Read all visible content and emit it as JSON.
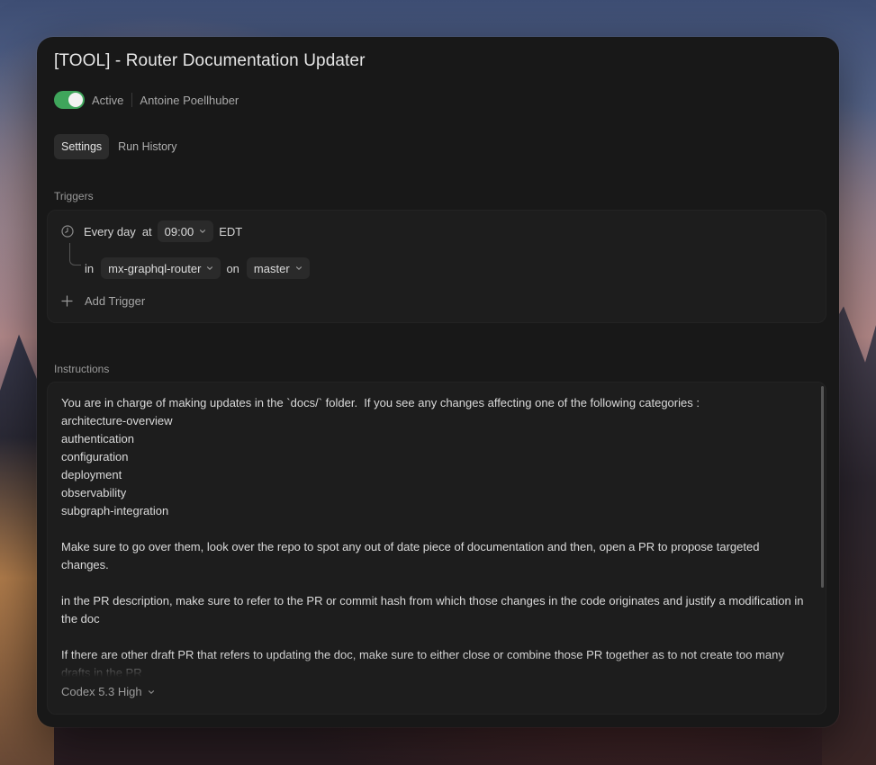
{
  "window": {
    "title": "[TOOL] - Router Documentation Updater",
    "status": {
      "active": true,
      "label": "Active",
      "owner": "Antoine Poellhuber"
    },
    "tabs": [
      {
        "label": "Settings",
        "active": true
      },
      {
        "label": "Run History",
        "active": false
      }
    ]
  },
  "triggers": {
    "section_label": "Triggers",
    "schedule": {
      "frequency": "Every day",
      "at_label": "at",
      "time": "09:00",
      "timezone": "EDT"
    },
    "repo": {
      "in_label": "in",
      "repository": "mx-graphql-router",
      "on_label": "on",
      "branch": "master"
    },
    "add_label": "Add Trigger"
  },
  "instructions": {
    "section_label": "Instructions",
    "text": "You are in charge of making updates in the `docs/` folder.  If you see any changes affecting one of the following categories :\narchitecture-overview\nauthentication\nconfiguration\ndeployment\nobservability\nsubgraph-integration\n\nMake sure to go over them, look over the repo to spot any out of date piece of documentation and then, open a PR to propose targeted changes.\n\nin the PR description, make sure to refer to the PR or commit hash from which those changes in the code originates and justify a modification in the doc\n\nIf there are other draft PR that refers to updating the doc, make sure to either close or combine those PR together as to not create too many drafts in the PR",
    "model": "Codex 5.3 High"
  },
  "colors": {
    "toggle_active": "#3fa55b",
    "panel_bg": "#181818",
    "box_bg": "#1d1d1d"
  },
  "icons": {
    "schedule": "clock-icon",
    "add": "plus-icon",
    "dropdown": "chevron-down-icon"
  }
}
